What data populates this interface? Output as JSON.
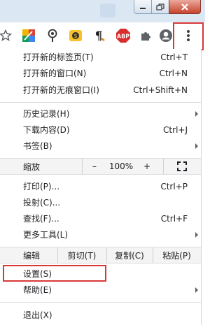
{
  "toolbar": {
    "extensions": [
      {
        "name": "star-icon"
      },
      {
        "name": "colorful-extension-icon"
      },
      {
        "name": "pin-extension-icon"
      },
      {
        "name": "dollar-extension-icon"
      },
      {
        "name": "paragraph-extension-icon"
      },
      {
        "name": "abp-extension-icon",
        "label": "ABP"
      },
      {
        "name": "puzzle-icon"
      },
      {
        "name": "profile-icon"
      },
      {
        "name": "more-vert-icon"
      }
    ]
  },
  "menu": {
    "new_tab": {
      "label": "打开新的标签页(T)",
      "shortcut": "Ctrl+T"
    },
    "new_window": {
      "label": "打开新的窗口(N)",
      "shortcut": "Ctrl+N"
    },
    "new_incognito": {
      "label": "打开新的无痕窗口(I)",
      "shortcut": "Ctrl+Shift+N"
    },
    "history": {
      "label": "历史记录(H)"
    },
    "downloads": {
      "label": "下载内容(D)",
      "shortcut": "Ctrl+J"
    },
    "bookmarks": {
      "label": "书签(B)"
    },
    "zoom": {
      "label": "缩放",
      "minus": "–",
      "value": "100%",
      "plus": "+"
    },
    "print": {
      "label": "打印(P)...",
      "shortcut": "Ctrl+P"
    },
    "cast": {
      "label": "投射(C)..."
    },
    "find": {
      "label": "查找(F)...",
      "shortcut": "Ctrl+F"
    },
    "more_tools": {
      "label": "更多工具(L)"
    },
    "edit": {
      "label": "编辑",
      "cut": "剪切(T)",
      "copy": "复制(C)",
      "paste": "粘贴(P)"
    },
    "settings": {
      "label": "设置(S)"
    },
    "help": {
      "label": "帮助(E)"
    },
    "exit": {
      "label": "退出(X)"
    }
  },
  "colors": {
    "highlight_box": "#d93838",
    "abp_red": "#d92d2d"
  }
}
